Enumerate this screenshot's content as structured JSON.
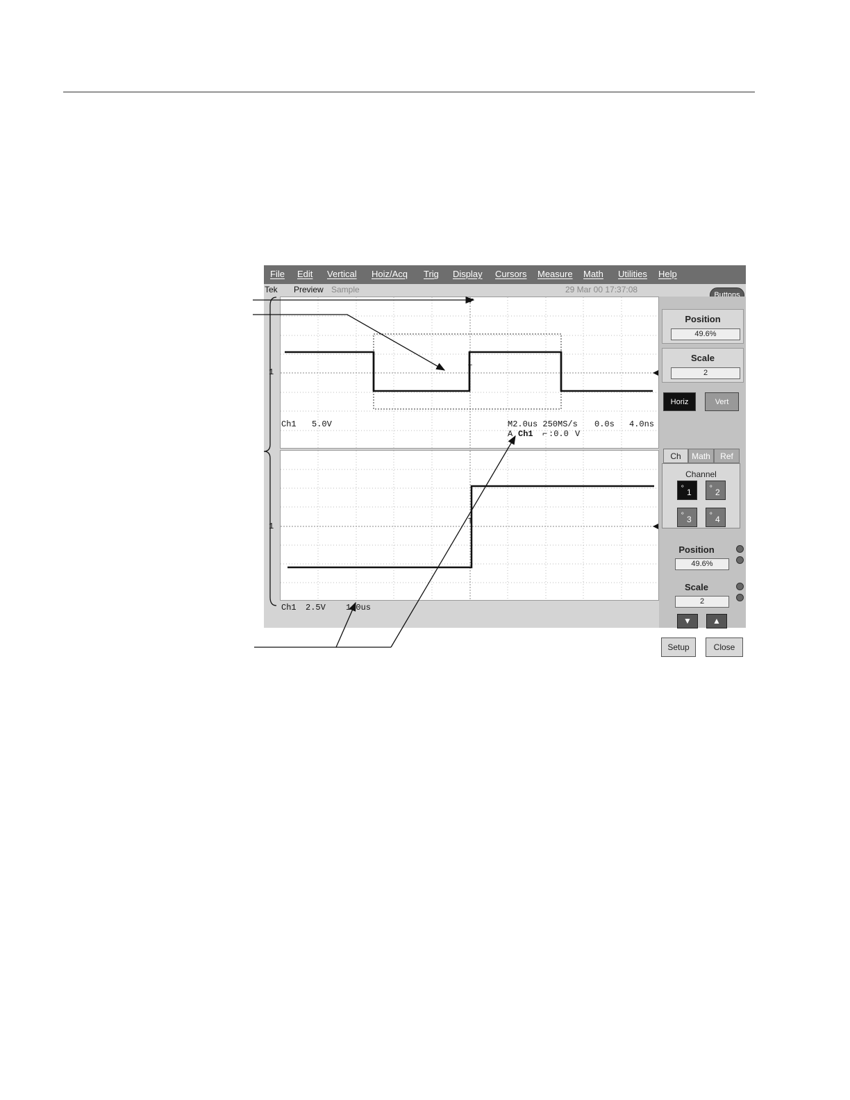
{
  "menu": [
    "File",
    "Edit",
    "Vertical",
    "Hoiz/Acq",
    "Trig",
    "Display",
    "Cursors",
    "Measure",
    "Math",
    "Utilities",
    "Help"
  ],
  "status": {
    "brand": "Tek",
    "mode1": "Preview",
    "mode2": "Sample",
    "datetime": "29 Mar 00 17:37:08"
  },
  "buttons_label": "Buttons",
  "upper": {
    "ch_label": "Ch1",
    "volts": "5.0V",
    "timebase": "M2.0us 250MS/s",
    "pos1": "0.0s",
    "pos2": "4.0ns",
    "trig_prefix": "A",
    "trig_ch": "Ch1",
    "trig_level": ":0.0",
    "trig_unit": "V",
    "marker": "1"
  },
  "lower": {
    "ch_label": "Ch1",
    "volts": "2.5V",
    "timebase": "1.0us",
    "marker": "1"
  },
  "panel": {
    "position_label": "Position",
    "position_value": "49.6%",
    "scale_label": "Scale",
    "scale_value": "2",
    "horiz": "Horiz",
    "vert": "Vert",
    "tabs": [
      "Ch",
      "Math",
      "Ref"
    ],
    "channel_label": "Channel",
    "channels": [
      "1",
      "2",
      "3",
      "4"
    ],
    "position2_label": "Position",
    "position2_value": "49.6%",
    "scale2_label": "Scale",
    "scale2_value": "2",
    "down": "▼",
    "up": "▲",
    "setup": "Setup",
    "close": "Close"
  }
}
